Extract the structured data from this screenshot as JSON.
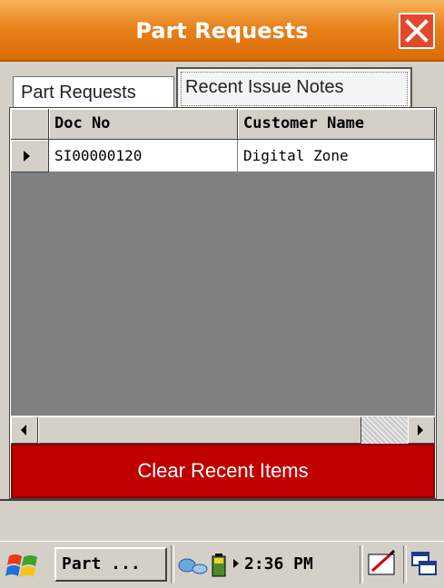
{
  "window": {
    "title": "Part Requests",
    "accent": "#e9821c"
  },
  "tabs": [
    {
      "label": "Part Requests",
      "selected": false
    },
    {
      "label": "Recent Issue Notes",
      "selected": true
    }
  ],
  "grid": {
    "columns": [
      "Doc No",
      "Customer Name"
    ],
    "rows": [
      {
        "doc_no": "SI00000120",
        "customer_name": "Digital Zone"
      }
    ]
  },
  "actions": {
    "clear_label": "Clear Recent Items",
    "clear_color": "#c00000"
  },
  "taskbar": {
    "task_label": "Part ...",
    "clock": "2:36 PM",
    "icons": [
      "windows-start-icon",
      "network-icon",
      "battery-icon",
      "arrow-right-icon",
      "input-panel-icon",
      "windows-switch-icon"
    ]
  }
}
